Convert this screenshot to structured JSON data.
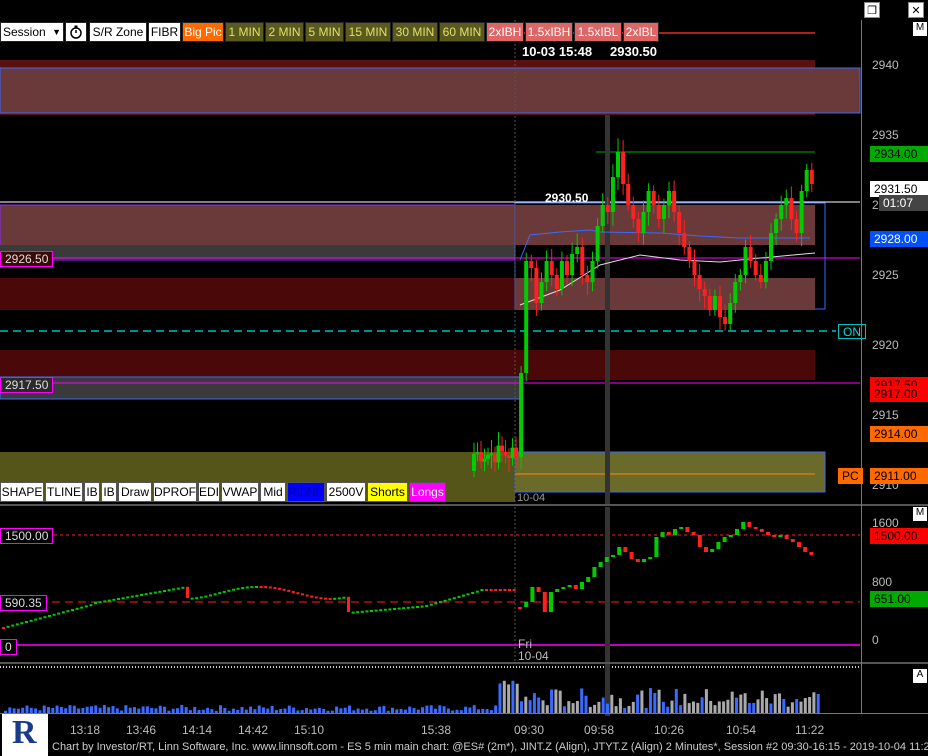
{
  "window": {
    "restore_icon": "restore-icon",
    "close_icon": "close-icon"
  },
  "toolbar": {
    "session_select": "Session",
    "timer_icon": "stopwatch-icon",
    "buttons": [
      {
        "label": "S/R Zone",
        "bg": "#ffffff",
        "fg": "#000000"
      },
      {
        "label": "FIBR",
        "bg": "#ffffff",
        "fg": "#000000"
      },
      {
        "label": "Big Pic",
        "bg": "#ff6a00",
        "fg": "#ffffff"
      },
      {
        "label": "1 MIN",
        "bg": "#5a5a1e",
        "fg": "#e0e070"
      },
      {
        "label": "2 MIN",
        "bg": "#5a5a1e",
        "fg": "#e0e070"
      },
      {
        "label": "5 MIN",
        "bg": "#5a5a1e",
        "fg": "#e0e070"
      },
      {
        "label": "15 MIN",
        "bg": "#5a5a1e",
        "fg": "#e0e070"
      },
      {
        "label": "30 MIN",
        "bg": "#5a5a1e",
        "fg": "#e0e070"
      },
      {
        "label": "60 MIN",
        "bg": "#5a5a1e",
        "fg": "#e0e070"
      },
      {
        "label": "2xIBH",
        "bg": "#d66",
        "fg": "#ffffff"
      },
      {
        "label": "1.5xIBH",
        "bg": "#d66",
        "fg": "#ffffff"
      },
      {
        "label": "1.5xIBL",
        "bg": "#d66",
        "fg": "#ffffff"
      },
      {
        "label": "2xIBL",
        "bg": "#d66",
        "fg": "#ffffff"
      }
    ]
  },
  "cursor_readout": {
    "datetime": "10-03 15:48",
    "price": "2930.50"
  },
  "price_axis": {
    "labels": [
      "2940",
      "2935",
      "2930",
      "2925",
      "2920",
      "2915",
      "2910"
    ],
    "pane_letter": "M"
  },
  "price_tags": [
    {
      "text": "2934.00",
      "bg": "#00aa00",
      "fg": "#000000"
    },
    {
      "text": "2931.50",
      "bg": "#ffffff",
      "fg": "#000000"
    },
    {
      "text": "01:07",
      "bg": "#444444",
      "fg": "#ffffff"
    },
    {
      "text": "2928.00",
      "bg": "#0050ff",
      "fg": "#ffffff"
    },
    {
      "text": "2917.50",
      "bg": "#ff0000",
      "fg": "#000000"
    },
    {
      "text": "2917.00",
      "bg": "#ff0000",
      "fg": "#000000"
    },
    {
      "text": "2914.00",
      "bg": "#ff6a00",
      "fg": "#000000"
    },
    {
      "text": "2911.00",
      "bg": "#ff6a00",
      "fg": "#000000"
    }
  ],
  "chart_labels": {
    "level_2926": "2926.50",
    "level_2917": "2917.50",
    "cursor_price": "2930.50",
    "on_tag": "ON",
    "pc_tag": "PC",
    "date_marker": "10-04",
    "day_marker": "Fri",
    "date_marker_lower": "10-04"
  },
  "bottom_toolbar": [
    {
      "label": "SHAPE",
      "bg": "#ffffff",
      "fg": "#000000"
    },
    {
      "label": "TLINE",
      "bg": "#ffffff",
      "fg": "#000000"
    },
    {
      "label": "IB",
      "bg": "#ffffff",
      "fg": "#000000"
    },
    {
      "label": "IB",
      "bg": "#ffffff",
      "fg": "#000000"
    },
    {
      "label": "Draw",
      "bg": "#ffffff",
      "fg": "#000000"
    },
    {
      "label": "DPROF",
      "bg": "#ffffff",
      "fg": "#000000"
    },
    {
      "label": "EDI",
      "bg": "#ffffff",
      "fg": "#000000"
    },
    {
      "label": "VWAP",
      "bg": "#ffffff",
      "fg": "#000000"
    },
    {
      "label": "Mid",
      "bg": "#ffffff",
      "fg": "#000000"
    },
    {
      "label": "RLINE",
      "bg": "#0000ff",
      "fg": "#0000aa"
    },
    {
      "label": "2500V",
      "bg": "#ffffff",
      "fg": "#000000"
    },
    {
      "label": "Shorts",
      "bg": "#ffff00",
      "fg": "#000000"
    },
    {
      "label": "Longs",
      "bg": "#ff00ff",
      "fg": "#ffffff"
    }
  ],
  "indicator_pane": {
    "axis_labels": [
      "1600",
      "800",
      "0"
    ],
    "tags": [
      {
        "text": "1500.00",
        "bg": "#ff0000",
        "fg": "#000000"
      },
      {
        "text": "651.00",
        "bg": "#00aa00",
        "fg": "#000000"
      }
    ],
    "left_labels": [
      "1500.00",
      "590.35",
      "0"
    ],
    "pane_letter": "M"
  },
  "volume_pane": {
    "pane_letter": "A"
  },
  "time_axis": [
    "13:18",
    "13:46",
    "14:14",
    "14:42",
    "15:10",
    "15:38",
    "09:30",
    "09:58",
    "10:26",
    "10:54",
    "11:22"
  ],
  "status_bar": "Chart by Investor/RT, Linn Software, Inc. www.linnsoft.com - ES 5 min main chart: @ES# (2m*), JINT.Z (Align), JTYT.Z (Align) 2 Minutes*, Session #2 09:30-16:15 - 2019-10-04 11:2",
  "logo_letter": "R",
  "colors": {
    "up": "#00cc00",
    "down": "#ff2020",
    "zone_red": "#6a1a1a",
    "zone_olive": "#55551a",
    "magenta": "#ff00ff",
    "cyan": "#00c0c0"
  }
}
